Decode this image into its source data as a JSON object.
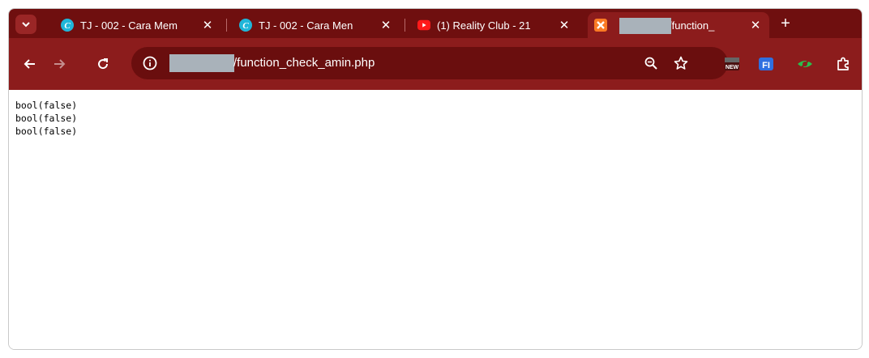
{
  "browser": {
    "tabs": [
      {
        "title": "TJ - 002 - Cara Mem",
        "favicon": "canva-icon",
        "active": false
      },
      {
        "title": "TJ - 002 - Cara Men",
        "favicon": "canva-icon",
        "active": false
      },
      {
        "title": "(1) Reality Club - 21",
        "favicon": "youtube-icon",
        "active": false
      },
      {
        "title": "/function_",
        "favicon": "xampp-icon",
        "active": true
      }
    ],
    "close_glyph": "✕",
    "new_tab_glyph": "+",
    "address_bar": {
      "url_visible": "/function_check_amin.php"
    },
    "colors": {
      "tabstrip": "#6f0f0f",
      "toolbar": "#8c1c1c",
      "omnibox": "#6a0e0e",
      "redaction": "#a9b2ba"
    },
    "extensions": [
      "new-badge-extension-icon",
      "fi-extension-icon",
      "green-eye-extension-icon",
      "puzzle-extensions-icon"
    ]
  },
  "page": {
    "output_lines": [
      "bool(false)",
      "bool(false)",
      "bool(false)"
    ]
  }
}
